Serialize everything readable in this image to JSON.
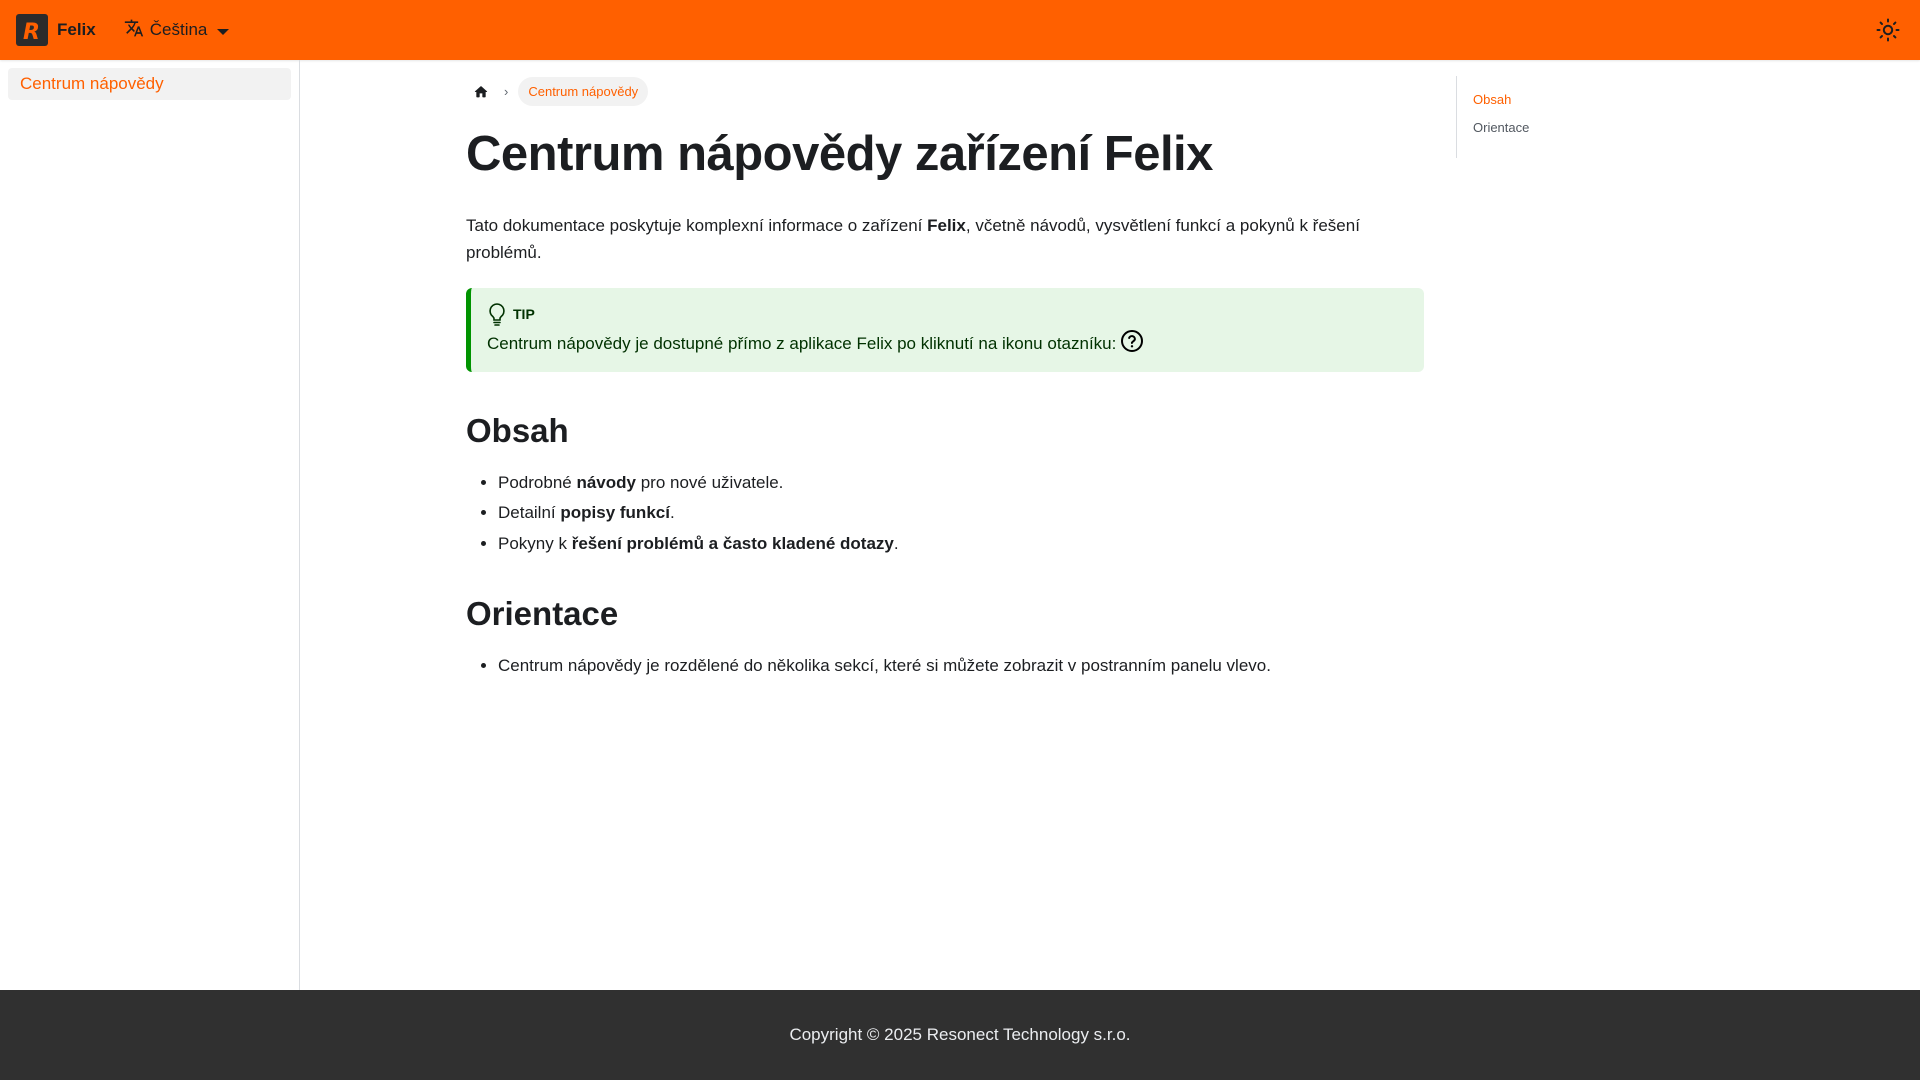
{
  "colors": {
    "primary": "#ff6000",
    "footer_bg": "#303030",
    "tip_bg": "#e6f6e6",
    "tip_border": "#009400"
  },
  "navbar": {
    "logo_letter": "R",
    "brand": "Felix",
    "language": "Čeština",
    "icons": {
      "language": "translate-icon",
      "theme": "sun-icon"
    }
  },
  "sidebar": {
    "items": [
      {
        "label": "Centrum nápovědy",
        "active": true
      }
    ]
  },
  "breadcrumb": {
    "home_icon": "home-icon",
    "current": "Centrum nápovědy"
  },
  "page": {
    "title": "Centrum nápovědy zařízení Felix",
    "intro": {
      "before": "Tato dokumentace poskytuje komplexní informace o zařízení ",
      "bold": "Felix",
      "after": ", včetně návodů, vysvětlení funkcí a pokynů k řešení problémů."
    },
    "tip": {
      "label": "TIP",
      "text": "Centrum nápovědy je dostupné přímo z aplikace Felix po kliknutí na ikonu otazníku:",
      "icon": "question-circle-icon"
    },
    "obsah": {
      "heading": "Obsah",
      "items": [
        {
          "before": "Podrobné ",
          "bold": "návody",
          "after": " pro nové uživatele."
        },
        {
          "before": "Detailní ",
          "bold": "popisy funkcí",
          "after": "."
        },
        {
          "before": "Pokyny k ",
          "bold": "řešení problémů a často kladené dotazy",
          "after": "."
        }
      ]
    },
    "orientace": {
      "heading": "Orientace",
      "items": [
        "Centrum nápovědy je rozdělené do několika sekcí, které si můžete zobrazit v postranním panelu vlevo."
      ]
    }
  },
  "toc": {
    "items": [
      {
        "label": "Obsah",
        "active": true
      },
      {
        "label": "Orientace",
        "active": false
      }
    ]
  },
  "footer": {
    "copyright": "Copyright © 2025 Resonect Technology s.r.o."
  }
}
